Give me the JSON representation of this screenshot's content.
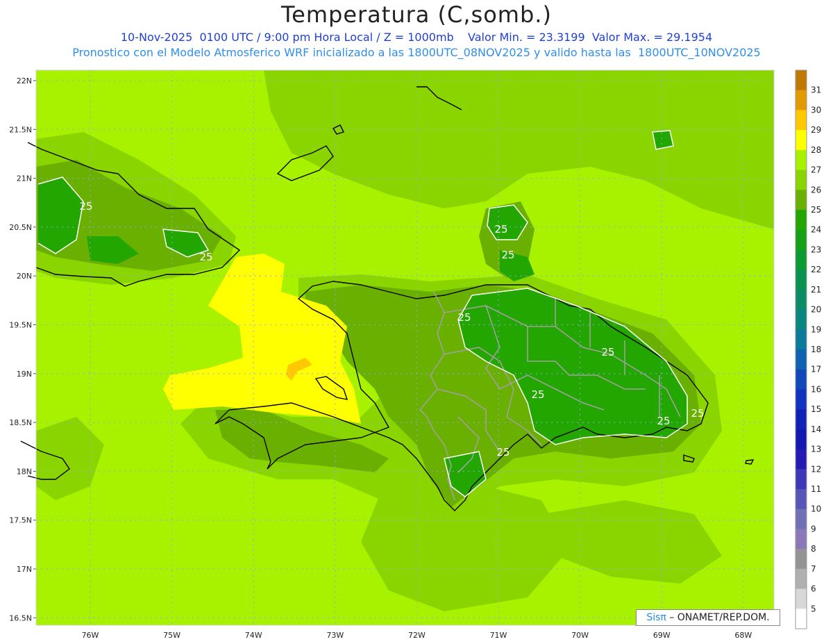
{
  "header": {
    "title": "Temperatura (C,somb.)",
    "line1": "10-Nov-2025  0100 UTC / 9:00 pm Hora Local / Z = 1000mb    Valor Min. = 23.3199  Valor Max. = 29.1954",
    "line2": "Pronostico con el Modelo Atmosferico WRF inicializado a las 1800UTC_08NOV2025 y valido hasta las  1800UTC_10NOV2025"
  },
  "map": {
    "lat_labels": [
      "22N",
      "21.5N",
      "21N",
      "20.5N",
      "20N",
      "19.5N",
      "19N",
      "18.5N",
      "18N",
      "17.5N",
      "17N",
      "16.5N"
    ],
    "lon_labels": [
      "76W",
      "75W",
      "74W",
      "73W",
      "72W",
      "71W",
      "70W",
      "69W",
      "68W"
    ],
    "contour_labels": [
      "25",
      "25",
      "25",
      "25",
      "25",
      "25",
      "25",
      "25",
      "25",
      "25"
    ],
    "colors": {
      "t27": "#a8f200",
      "t26": "#8ad400",
      "t25": "#6ab000",
      "t24": "#24a600",
      "t28": "#ffff00",
      "t29": "#ffc800",
      "grid": "#8aa8ff",
      "coast": "#000000",
      "border": "#a0a0a0",
      "contour": "#ffffff"
    }
  },
  "colorbar": {
    "labels": [
      "31",
      "30",
      "29",
      "28",
      "27",
      "26",
      "25",
      "24",
      "23",
      "22",
      "21",
      "20",
      "19",
      "18",
      "17",
      "16",
      "15",
      "14",
      "13",
      "12",
      "11",
      "10",
      "9",
      "8",
      "7",
      "6",
      "5"
    ],
    "colors": [
      "#c07800",
      "#e39a00",
      "#ffc800",
      "#ffff00",
      "#a8f200",
      "#8ad400",
      "#6ab000",
      "#24a600",
      "#16a016",
      "#0c9a32",
      "#089450",
      "#0a8c66",
      "#0a8680",
      "#0c7a99",
      "#0e62b0",
      "#1048bc",
      "#1232c0",
      "#1222b8",
      "#1218b0",
      "#241ab4",
      "#3c38b8",
      "#5656b8",
      "#7070b4",
      "#8a78b8",
      "#949494",
      "#b0b0b0",
      "#d8d8d8",
      "#ffffff"
    ]
  },
  "footer": {
    "logo": "Sisπ",
    "credit": " – ONAMET/REP.DOM."
  }
}
